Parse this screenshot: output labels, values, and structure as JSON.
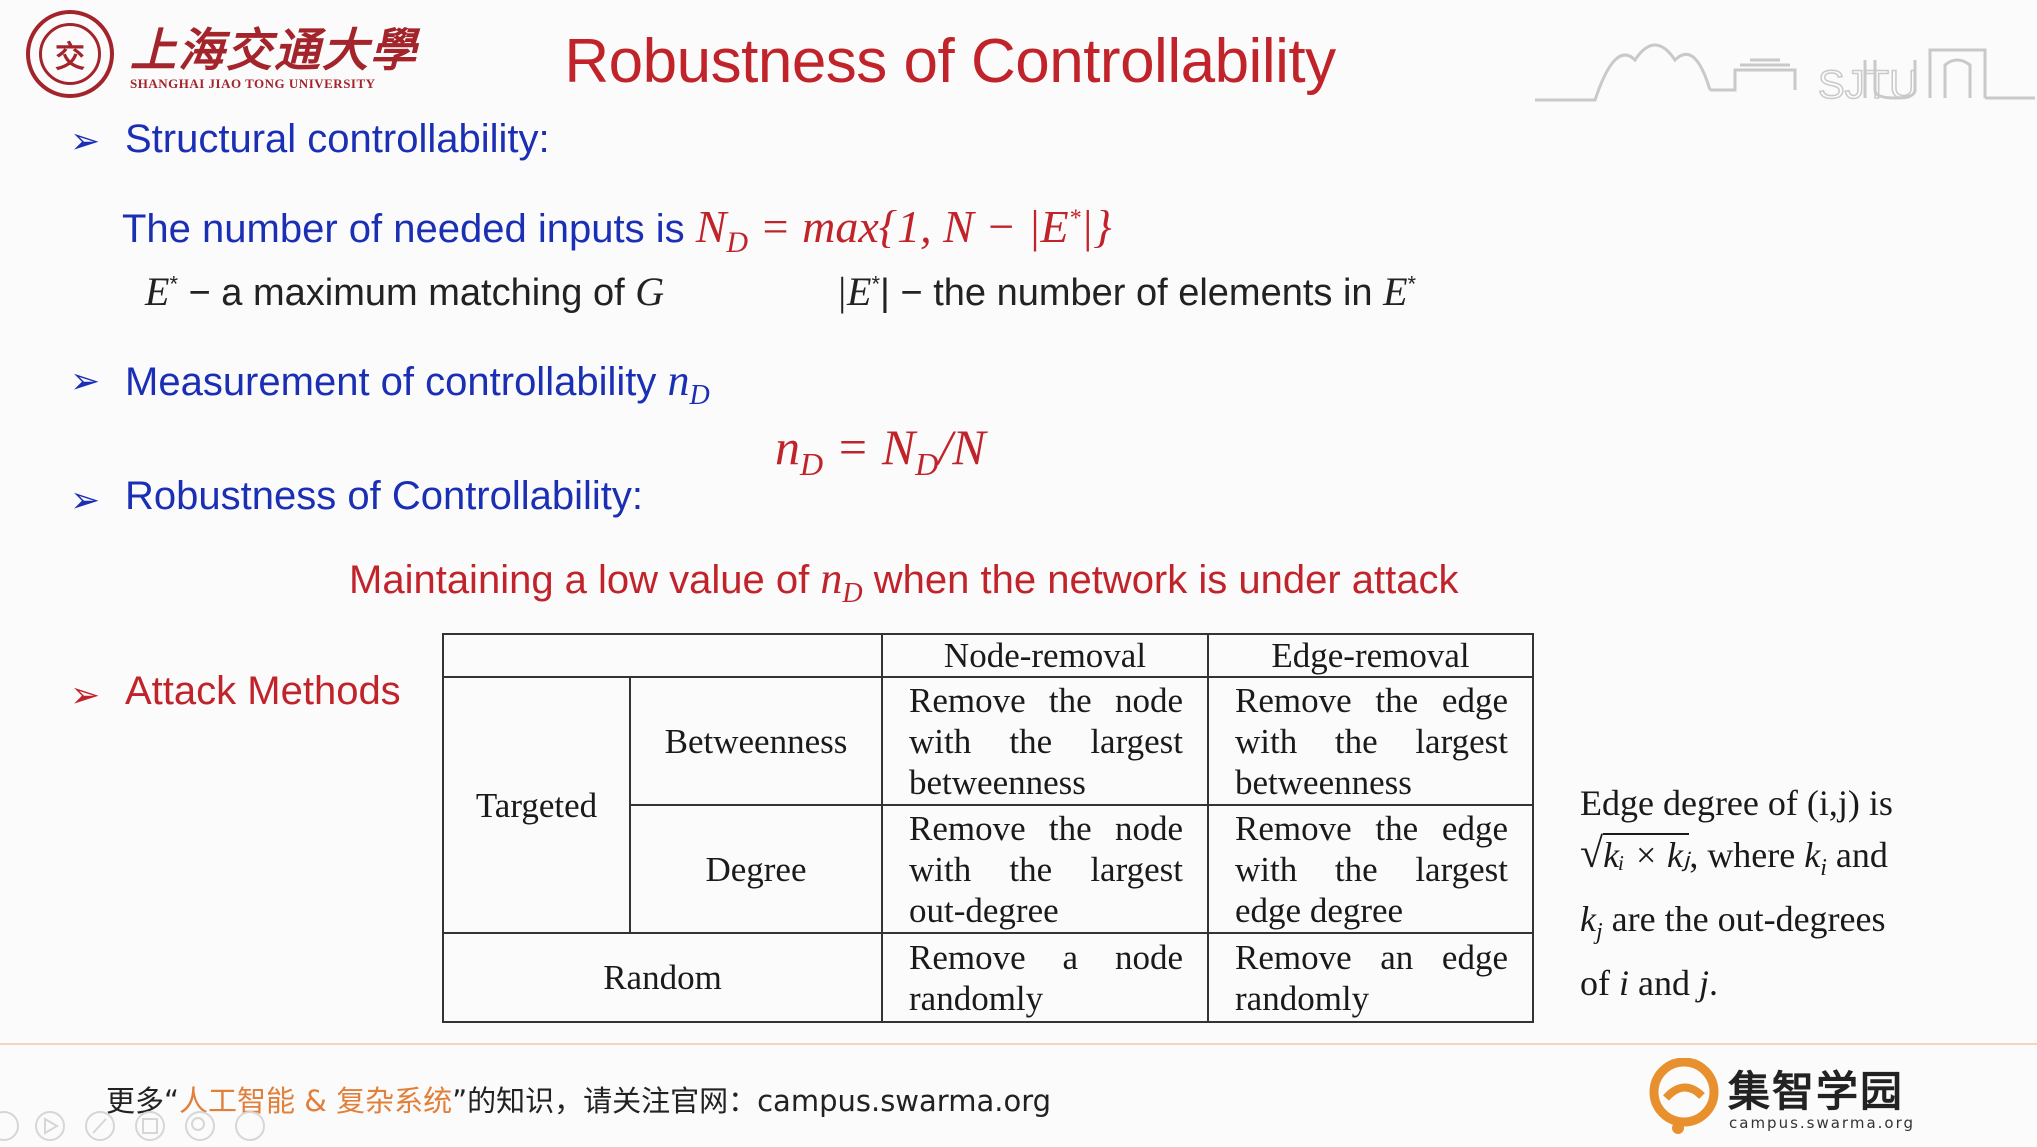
{
  "header": {
    "logo_seal_glyph": "交",
    "university_cn": "上海交通大學",
    "university_en": "SHANGHAI JIAO TONG UNIVERSITY",
    "title": "Robustness of Controllability",
    "campus_art_text": "SJTU"
  },
  "sections": {
    "structural": {
      "heading": "Structural controllability:",
      "needed_inputs_text": "The number of needed inputs is ",
      "formula_ND": "N",
      "formula_ND_sub": "D",
      "formula_rhs": " = max{1, N − |E",
      "formula_rhs_end": "|}",
      "def_E_symbol": "E",
      "def_E_text": " − a maximum matching of ",
      "def_E_G": "G",
      "def_card_symbol": "|E",
      "def_card_close": "| − ",
      "def_card_text": "the number of elements in ",
      "def_card_E": "E"
    },
    "measurement": {
      "heading": "Measurement of controllability ",
      "nd_symbol": "n",
      "nd_sub": "D",
      "formula_lhs": "n",
      "formula_lhs_sub": "D",
      "formula_eq": " = N",
      "formula_mid_sub": "D",
      "formula_end": "/N"
    },
    "robustness": {
      "heading": "Robustness of Controllability:",
      "statement_pre": "Maintaining a low value of ",
      "statement_symbol": "n",
      "statement_sub": "D",
      "statement_post": " when the network is under attack"
    },
    "attack": {
      "heading": "Attack Methods",
      "table": {
        "col_node": "Node-removal",
        "col_edge": "Edge-removal",
        "targeted": "Targeted",
        "betweenness": "Betweenness",
        "degree": "Degree",
        "random": "Random",
        "bet_node": "Remove the node with the largest betweenness",
        "bet_edge": "Remove the edge with the largest betweenness",
        "deg_node": "Remove the node with the largest out-degree",
        "deg_edge": "Remove the edge with the largest edge degree",
        "rand_node": "Remove a node randomly",
        "rand_edge": "Remove an edge randomly"
      },
      "note": {
        "line1": "Edge degree of (i,j) is",
        "sqrt_content": "kᵢ × kⱼ",
        "line2_after": ", where ",
        "line2_k": "k",
        "line2_ksub": "i",
        "line2_end": " and",
        "line3_k": "k",
        "line3_ksub": "j",
        "line3_text": " are the out-degrees",
        "line4_pre": "of ",
        "line4_i": "i",
        "line4_mid": " and ",
        "line4_j": "j",
        "line4_end": "."
      }
    }
  },
  "footer": {
    "text_pre": "更多“",
    "text_hl": "人工智能 & 复杂系统",
    "text_post": "”的知识，请关注官网：campus.swarma.org",
    "brand_cn": "集智学园",
    "brand_url": "campus.swarma.org"
  },
  "colors": {
    "title_red": "#c1232b",
    "heading_blue": "#1b2fb5",
    "brand_orange": "#e0803a"
  }
}
